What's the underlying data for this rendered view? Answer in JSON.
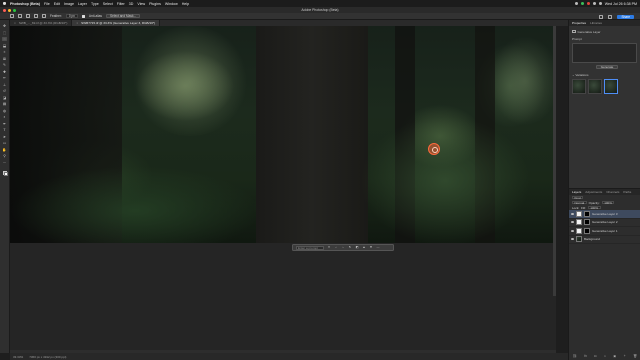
{
  "menubar": {
    "app_name": "Photoshop (Beta)",
    "items": [
      "File",
      "Edit",
      "Image",
      "Layer",
      "Type",
      "Select",
      "Filter",
      "3D",
      "View",
      "Plugins",
      "Window",
      "Help"
    ],
    "clock": "Wed Jul 26  6:38 PM"
  },
  "window": {
    "title": "Adobe Photoshop (Beta)"
  },
  "options": {
    "feather_label": "Feather:",
    "feather_value": "0 px",
    "antialias_label": "Anti-alias",
    "select_mask_label": "Select and Mask...",
    "share_label": "Share"
  },
  "tabs": [
    {
      "label": "SWB_..._69.tif @ 33.3% (RGB/16*)",
      "active": false
    },
    {
      "label": "SWB7715.tif @ 33.3% (Generative Layer 3, RGB/16*)",
      "active": true
    }
  ],
  "tools": [
    "move-tool",
    "marquee-tool",
    "lasso-tool",
    "object-select-tool",
    "crop-tool",
    "frame-tool",
    "eyedropper-tool",
    "healing-tool",
    "brush-tool",
    "stamp-tool",
    "history-brush-tool",
    "eraser-tool",
    "gradient-tool",
    "blur-tool",
    "dodge-tool",
    "pen-tool",
    "type-tool",
    "path-select-tool",
    "shape-tool",
    "hand-tool",
    "zoom-tool",
    "more-tools"
  ],
  "taskbar": {
    "prompt_placeholder": "Enter a prompt",
    "generate_label": "Generate"
  },
  "status": {
    "zoom": "33.33%",
    "doc_info": "7360 px x 4912 px (300 ppi)"
  },
  "properties": {
    "tabs": [
      "Properties",
      "Libraries"
    ],
    "layer_type": "Generative Layer",
    "prompt_label": "Prompt",
    "generate_label": "Generate",
    "variations_label": "Variations",
    "variation_count": 3
  },
  "layers": {
    "tabs": [
      "Layers",
      "Adjustments",
      "Channels",
      "Paths"
    ],
    "kind_label": "Kind",
    "blend_mode": "Normal",
    "opacity_label": "Opacity:",
    "opacity": "100%",
    "lock_label": "Lock:",
    "fill_label": "Fill:",
    "fill": "100%",
    "items": [
      {
        "name": "Generative Layer 3",
        "selected": true,
        "kind": "generative"
      },
      {
        "name": "Generative Layer 2",
        "selected": false,
        "kind": "generative"
      },
      {
        "name": "Generative Layer 1",
        "selected": false,
        "kind": "generative"
      },
      {
        "name": "Background",
        "selected": false,
        "kind": "photo"
      }
    ],
    "footer_icons": [
      "link-icon",
      "fx-icon",
      "mask-icon",
      "adjustment-icon",
      "group-icon",
      "new-layer-icon",
      "trash-icon"
    ]
  },
  "colors": {
    "accent": "#2c7be5",
    "selected_layer": "#3e4a5e",
    "brush_cursor": "#ff6a3d"
  }
}
